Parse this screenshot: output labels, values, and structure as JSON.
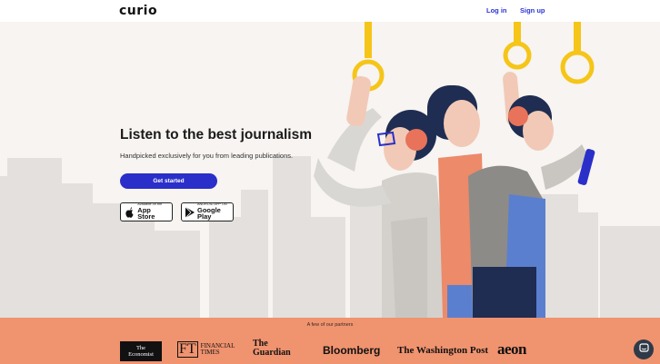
{
  "header": {
    "logo": "curio",
    "login_label": "Log in",
    "signup_label": "Sign up"
  },
  "hero": {
    "headline": "Listen to the best journalism",
    "subheadline": "Handpicked exclusively for you from leading publications.",
    "cta_label": "Get started",
    "app_store": {
      "small": "Available on the",
      "big": "App Store"
    },
    "google_play": {
      "small": "ANDROID APP ON",
      "big": "Google Play"
    }
  },
  "partners": {
    "title": "A few of our partners",
    "logos": {
      "economist_line1": "The",
      "economist_line2": "Economist",
      "ft_mark": "FT",
      "ft_line1": "FINANCIAL",
      "ft_line2": "TIMES",
      "guardian_line1": "The",
      "guardian_line2": "Guardian",
      "bloomberg": "Bloomberg",
      "wapo": "The Washington Post",
      "aeon": "aeon"
    }
  },
  "colors": {
    "accent": "#2a2fc9",
    "link": "#2b34d6",
    "hero_bg": "#f7f4f1",
    "partners_bg": "#f0936f",
    "strap_yellow": "#f5c518"
  }
}
